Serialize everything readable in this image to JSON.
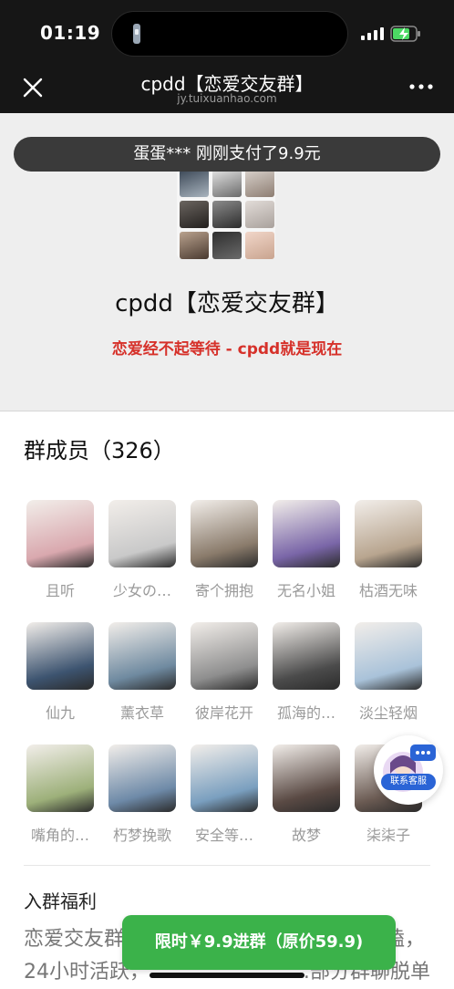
{
  "status_bar": {
    "time": "01:19"
  },
  "nav": {
    "title": "cpdd【恋爱交友群】",
    "subtitle": "jy.tuixuanhao.com"
  },
  "ticker": {
    "text": "蛋蛋*** 刚刚支付了9.9元"
  },
  "group": {
    "name": "cpdd【恋爱交友群】",
    "slogan": "恋爱经不起等待 - cpdd就是现在"
  },
  "members": {
    "title": "群成员（326）",
    "items": [
      {
        "name": "且听",
        "tone": "#d9a8ae"
      },
      {
        "name": "少女の…",
        "tone": "#c9c9c9"
      },
      {
        "name": "寄个拥抱",
        "tone": "#8a7b6b"
      },
      {
        "name": "无名小姐",
        "tone": "#7a66a8"
      },
      {
        "name": "枯酒无味",
        "tone": "#b8a58f"
      },
      {
        "name": "仙九",
        "tone": "#3d5470"
      },
      {
        "name": "薰衣草",
        "tone": "#6f8aa0"
      },
      {
        "name": "彼岸花开",
        "tone": "#8e8e8e"
      },
      {
        "name": "孤海的…",
        "tone": "#4b4b4b"
      },
      {
        "name": "淡尘轻烟",
        "tone": "#a9c2d9"
      },
      {
        "name": "嘴角的…",
        "tone": "#9db07a"
      },
      {
        "name": "朽梦挽歌",
        "tone": "#6e8aa8"
      },
      {
        "name": "安全等…",
        "tone": "#7a9fbf"
      },
      {
        "name": "故梦",
        "tone": "#5a4a44"
      },
      {
        "name": "柒柒子",
        "tone": "#6a5a52"
      }
    ]
  },
  "benefits": {
    "title": "入群福利",
    "text": "恋爱交友群，……………………………唠嗑，24小时活跃，……………………部分群聊脱单"
  },
  "floating_service": {
    "label": "联系客服"
  },
  "join_button": {
    "label": "限时￥9.9进群（原价59.9)"
  },
  "colors": {
    "accent_green": "#3bb24a",
    "slogan_red": "#d6312a",
    "service_blue": "#2a64d6"
  }
}
